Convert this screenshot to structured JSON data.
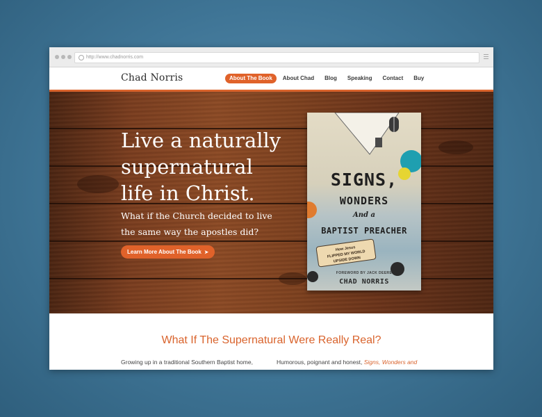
{
  "browser": {
    "url": "http://www.chadnorris.com"
  },
  "header": {
    "brand": "Chad Norris",
    "nav": [
      {
        "label": "About The Book",
        "active": true
      },
      {
        "label": "About Chad",
        "active": false
      },
      {
        "label": "Blog",
        "active": false
      },
      {
        "label": "Speaking",
        "active": false
      },
      {
        "label": "Contact",
        "active": false
      },
      {
        "label": "Buy",
        "active": false
      }
    ]
  },
  "hero": {
    "headline_lines": [
      "Live a naturally",
      "supernatural",
      "life in Christ."
    ],
    "subtitle_lines": [
      "What if the Church decided to live",
      "the same way the apostles did?"
    ],
    "cta_label": "Learn More About The Book",
    "cta_icon": "arrow-circle-icon"
  },
  "book_cover": {
    "title_line1": "SIGNS,",
    "title_line2": "WONDERS",
    "title_line3": "And a",
    "title_line4": "BAPTIST PREACHER",
    "tag_line1": "How Jesus",
    "tag_line2": "FLIPPED MY WORLD",
    "tag_line3": "UPSIDE DOWN",
    "foreword": "FOREWORD BY JACK DEERE",
    "author": "CHAD NORRIS"
  },
  "section": {
    "title": "What If The Supernatural Were Really Real?",
    "left_text": "Growing up in a traditional Southern Baptist home, Chad",
    "right_text_before": "Humorous, poignant and honest, ",
    "right_text_accent": "Signs, Wonders and a",
    "colors": {
      "accent": "#d9632c",
      "text": "#444444"
    }
  },
  "colors": {
    "accent": "#e0622a",
    "background": "#3f7596"
  }
}
